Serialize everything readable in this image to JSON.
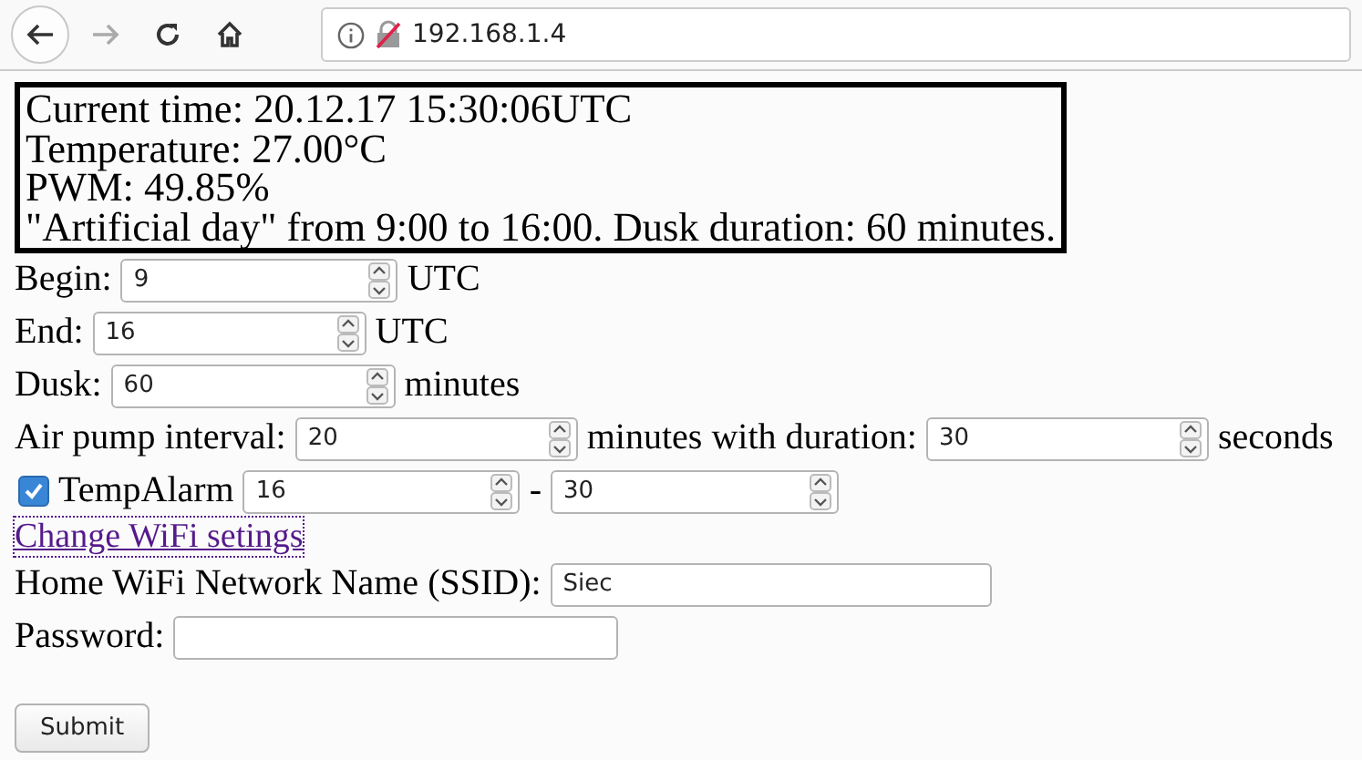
{
  "browser": {
    "address": "192.168.1.4"
  },
  "status_box": {
    "lines": [
      "Current time: 20.12.17 15:30:06UTC",
      "Temperature: 27.00°C",
      "PWM: 49.85%",
      "\"Artificial day\" from 9:00 to 16:00. Dusk duration: 60 minutes."
    ]
  },
  "form_rows": [
    {
      "parts": [
        {
          "label": "Begin:",
          "value": "9"
        },
        {
          "label": "UTC"
        }
      ]
    },
    {
      "parts": [
        {
          "label": "End:",
          "value": "16"
        },
        {
          "label": "UTC"
        }
      ]
    },
    {
      "parts": [
        {
          "label": "Dusk:",
          "value": "60"
        },
        {
          "label": "minutes"
        }
      ]
    },
    {
      "parts": [
        {
          "label": "Air pump interval:",
          "value": "20"
        },
        {
          "label": "minutes with duration:",
          "value": "30"
        },
        {
          "label": "seconds"
        }
      ]
    }
  ],
  "temp_alarm": {
    "checked": true,
    "label": "TempAlarm",
    "low": "16",
    "separator": "-",
    "high": "30"
  },
  "wifi_link": "Change WiFi setings",
  "wifi_fields": [
    {
      "label": "Home WiFi Network Name (SSID):",
      "value": "Siec"
    },
    {
      "label": "Password:"
    }
  ],
  "submit": "Submit"
}
